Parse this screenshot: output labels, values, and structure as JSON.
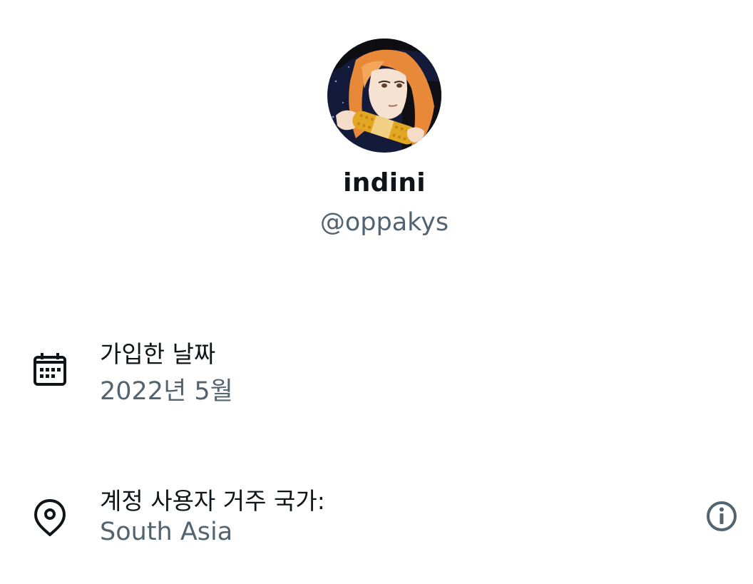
{
  "profile": {
    "avatar_icon": "profile-avatar-illustration",
    "display_name": "indini",
    "handle": "@oppakys"
  },
  "joined": {
    "icon": "calendar-icon",
    "label": "가입한 날짜",
    "value": "2022년 5월"
  },
  "location": {
    "icon": "location-pin-icon",
    "label": "계정 사용자 거주 국가:",
    "value": "South Asia",
    "info_icon": "info-icon"
  },
  "colors": {
    "primary_text": "#0f1419",
    "secondary_text": "#536471",
    "background": "#ffffff"
  }
}
